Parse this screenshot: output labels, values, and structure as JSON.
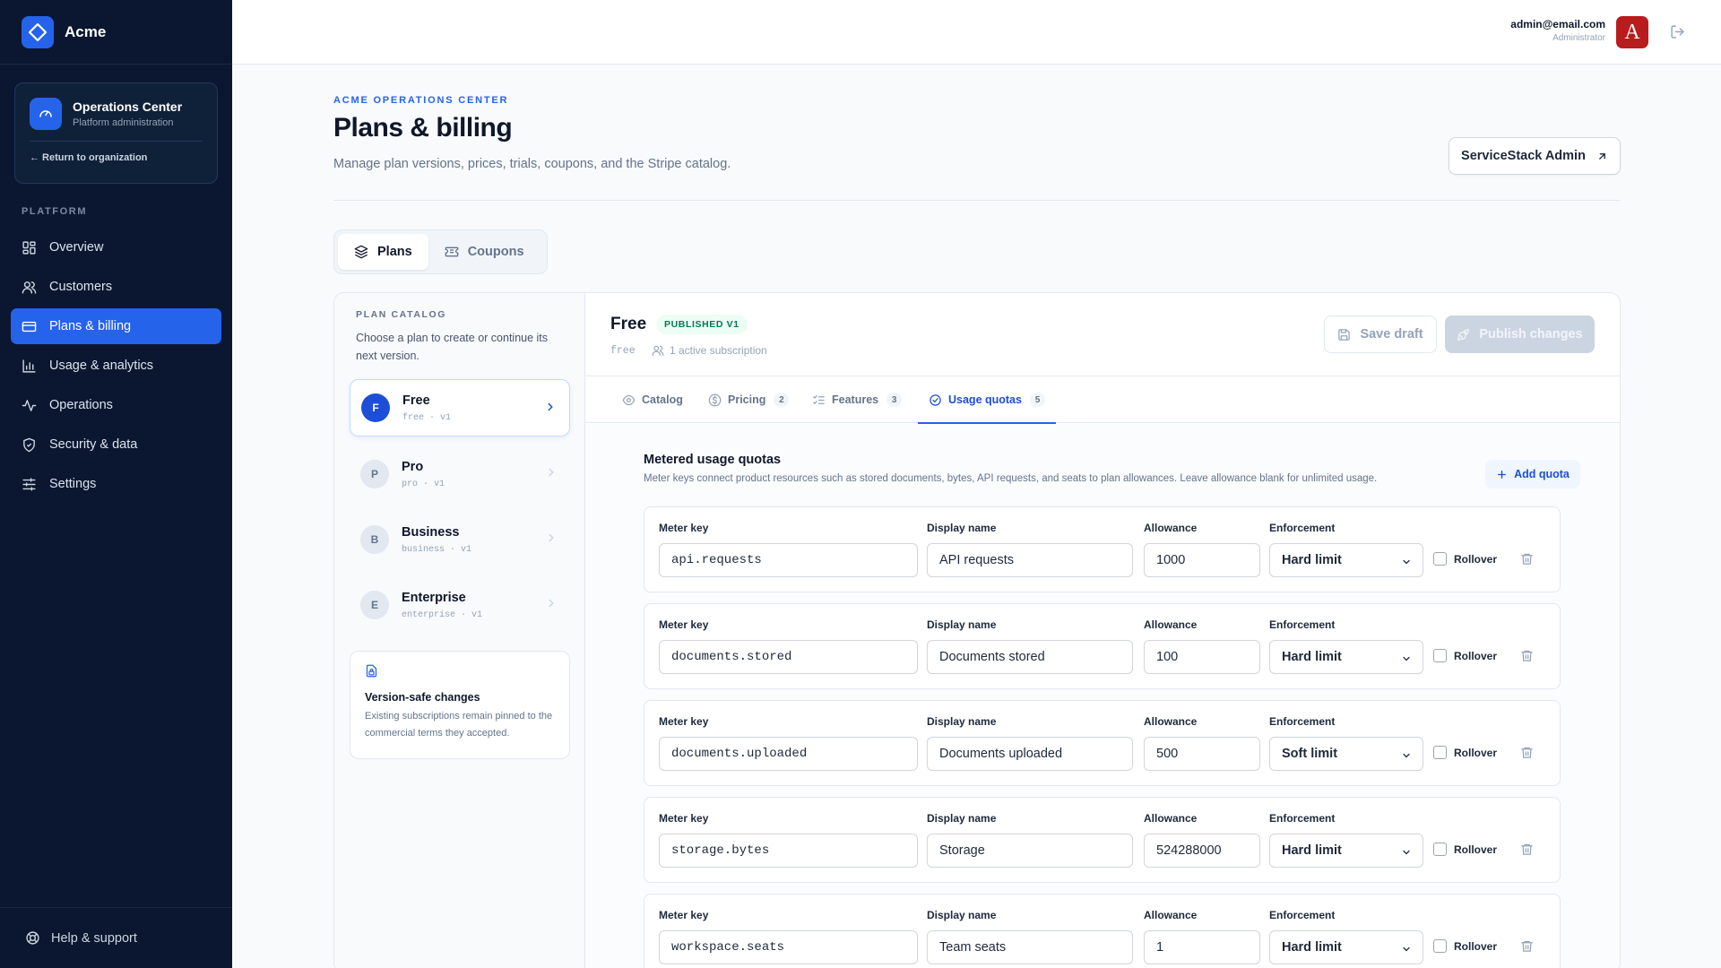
{
  "brand": {
    "name": "Acme"
  },
  "ops_card": {
    "title": "Operations Center",
    "subtitle": "Platform administration",
    "return_label": "← Return to organization"
  },
  "sidebar": {
    "section_label": "PLATFORM",
    "items": [
      {
        "label": "Overview",
        "icon": "grid-icon"
      },
      {
        "label": "Customers",
        "icon": "users-icon"
      },
      {
        "label": "Plans & billing",
        "icon": "credit-card-icon",
        "active": true
      },
      {
        "label": "Usage & analytics",
        "icon": "bar-chart-icon"
      },
      {
        "label": "Operations",
        "icon": "activity-icon"
      },
      {
        "label": "Security & data",
        "icon": "shield-icon"
      },
      {
        "label": "Settings",
        "icon": "sliders-icon"
      }
    ],
    "help_label": "Help & support"
  },
  "topbar": {
    "user_email": "admin@email.com",
    "user_role": "Administrator",
    "avatar_letter": "A"
  },
  "page": {
    "eyebrow": "ACME OPERATIONS CENTER",
    "title": "Plans & billing",
    "subtitle": "Manage plan versions, prices, trials, coupons, and the Stripe catalog.",
    "servicestack_label": "ServiceStack Admin"
  },
  "segments": {
    "plans": "Plans",
    "coupons": "Coupons"
  },
  "catalog": {
    "label": "PLAN CATALOG",
    "description": "Choose a plan to create or continue its next version.",
    "plans": [
      {
        "letter": "F",
        "name": "Free",
        "meta": "free · v1"
      },
      {
        "letter": "P",
        "name": "Pro",
        "meta": "pro · v1"
      },
      {
        "letter": "B",
        "name": "Business",
        "meta": "business · v1"
      },
      {
        "letter": "E",
        "name": "Enterprise",
        "meta": "enterprise · v1"
      }
    ],
    "version_title": "Version-safe changes",
    "version_desc": "Existing subscriptions remain pinned to the commercial terms they accepted."
  },
  "editor": {
    "title": "Free",
    "badge": "PUBLISHED V1",
    "slug": "free",
    "subscriptions": "1 active subscription",
    "save_label": "Save draft",
    "publish_label": "Publish changes",
    "tabs": [
      {
        "label": "Catalog",
        "count": ""
      },
      {
        "label": "Pricing",
        "count": "2"
      },
      {
        "label": "Features",
        "count": "3"
      },
      {
        "label": "Usage quotas",
        "count": "5"
      }
    ],
    "section_title": "Metered usage quotas",
    "section_desc": "Meter keys connect product resources such as stored documents, bytes, API requests, and seats to plan allowances. Leave allowance blank for unlimited usage.",
    "add_label": "Add quota",
    "col_labels": {
      "meter": "Meter key",
      "display": "Display name",
      "allowance": "Allowance",
      "enforcement": "Enforcement",
      "rollover": "Rollover"
    },
    "quotas": [
      {
        "meter": "api.requests",
        "display": "API requests",
        "allowance": "1000",
        "enforcement": "Hard limit"
      },
      {
        "meter": "documents.stored",
        "display": "Documents stored",
        "allowance": "100",
        "enforcement": "Hard limit"
      },
      {
        "meter": "documents.uploaded",
        "display": "Documents uploaded",
        "allowance": "500",
        "enforcement": "Soft limit"
      },
      {
        "meter": "storage.bytes",
        "display": "Storage",
        "allowance": "524288000",
        "enforcement": "Hard limit"
      },
      {
        "meter": "workspace.seats",
        "display": "Team seats",
        "allowance": "1",
        "enforcement": "Hard limit"
      }
    ]
  },
  "colors": {
    "sidebar_bg": "#0b1730",
    "accent": "#2563eb",
    "avatar": "#b91c1c",
    "published": "#047857"
  }
}
